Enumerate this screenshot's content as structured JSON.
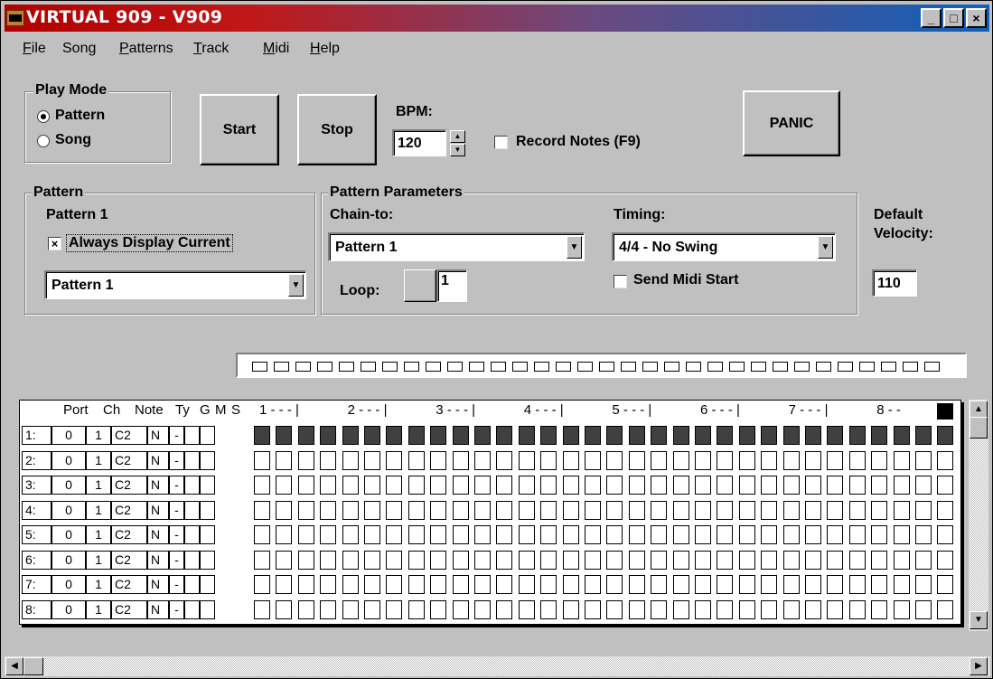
{
  "window": {
    "title": "VIRTUAL  909 - V909",
    "minimize_glyph": "_",
    "maximize_glyph": "□",
    "close_glyph": "×",
    "titlebar_colors": [
      "#b00000",
      "#1060b8"
    ]
  },
  "menu": [
    {
      "pre": "",
      "ul": "F",
      "post": "ile"
    },
    {
      "pre": "Song",
      "ul": "",
      "post": ""
    },
    {
      "pre": "",
      "ul": "P",
      "post": "atterns"
    },
    {
      "pre": "",
      "ul": "T",
      "post": "rack"
    },
    {
      "pre": "",
      "ul": "M",
      "post": "idi"
    },
    {
      "pre": "",
      "ul": "H",
      "post": "elp"
    }
  ],
  "play_mode": {
    "label": "Play Mode",
    "options": [
      "Pattern",
      "Song"
    ],
    "selected": "Pattern"
  },
  "buttons": {
    "start": "Start",
    "stop": "Stop",
    "panic": "PANIC"
  },
  "bpm": {
    "label": "BPM:",
    "value": "120"
  },
  "record_notes": {
    "label": "Record Notes (F9)",
    "checked": false
  },
  "pattern_group": {
    "label": "Pattern",
    "current": "Pattern 1",
    "always_display": {
      "label": "Always Display Current",
      "checked": true,
      "mark": "×"
    },
    "selected": "Pattern 1"
  },
  "pattern_params": {
    "label": "Pattern Parameters",
    "chain_label": "Chain-to:",
    "chain_value": "Pattern 1",
    "loop_label": "Loop:",
    "loop_value": "1",
    "timing_label": "Timing:",
    "timing_value": "4/4 - No Swing",
    "send_midi_start": {
      "label": "Send Midi Start",
      "checked": false
    }
  },
  "default_velocity": {
    "label_line1": "Default",
    "label_line2": "Velocity:",
    "value": "110"
  },
  "step_indicator_count": 32,
  "sequencer": {
    "headers": {
      "port": "Port",
      "ch": "Ch",
      "note": "Note",
      "ty": "Ty",
      "g": "G",
      "m": "M",
      "s": "S"
    },
    "beat_labels": [
      "1 -  -  - |",
      "2 -  -  - |",
      "3 -  -  - |",
      "4 -  -  - |",
      "5 -  -  - |",
      "6 -  -  - |",
      "7 -  -  - |",
      "8 -  -  "
    ],
    "current_step": 32,
    "steps_per_row": 32,
    "rows": [
      {
        "num": "1:",
        "port": "0",
        "ch": "1",
        "note": "C2",
        "ty": "N",
        "g": "-",
        "filled": true
      },
      {
        "num": "2:",
        "port": "0",
        "ch": "1",
        "note": "C2",
        "ty": "N",
        "g": "-",
        "filled": false
      },
      {
        "num": "3:",
        "port": "0",
        "ch": "1",
        "note": "C2",
        "ty": "N",
        "g": "-",
        "filled": false
      },
      {
        "num": "4:",
        "port": "0",
        "ch": "1",
        "note": "C2",
        "ty": "N",
        "g": "-",
        "filled": false
      },
      {
        "num": "5:",
        "port": "0",
        "ch": "1",
        "note": "C2",
        "ty": "N",
        "g": "-",
        "filled": false
      },
      {
        "num": "6:",
        "port": "0",
        "ch": "1",
        "note": "C2",
        "ty": "N",
        "g": "-",
        "filled": false
      },
      {
        "num": "7:",
        "port": "0",
        "ch": "1",
        "note": "C2",
        "ty": "N",
        "g": "-",
        "filled": false
      },
      {
        "num": "8:",
        "port": "0",
        "ch": "1",
        "note": "C2",
        "ty": "N",
        "g": "-",
        "filled": false
      }
    ]
  },
  "scroll_glyphs": {
    "up": "▲",
    "down": "▼",
    "left": "◀",
    "right": "▶"
  }
}
